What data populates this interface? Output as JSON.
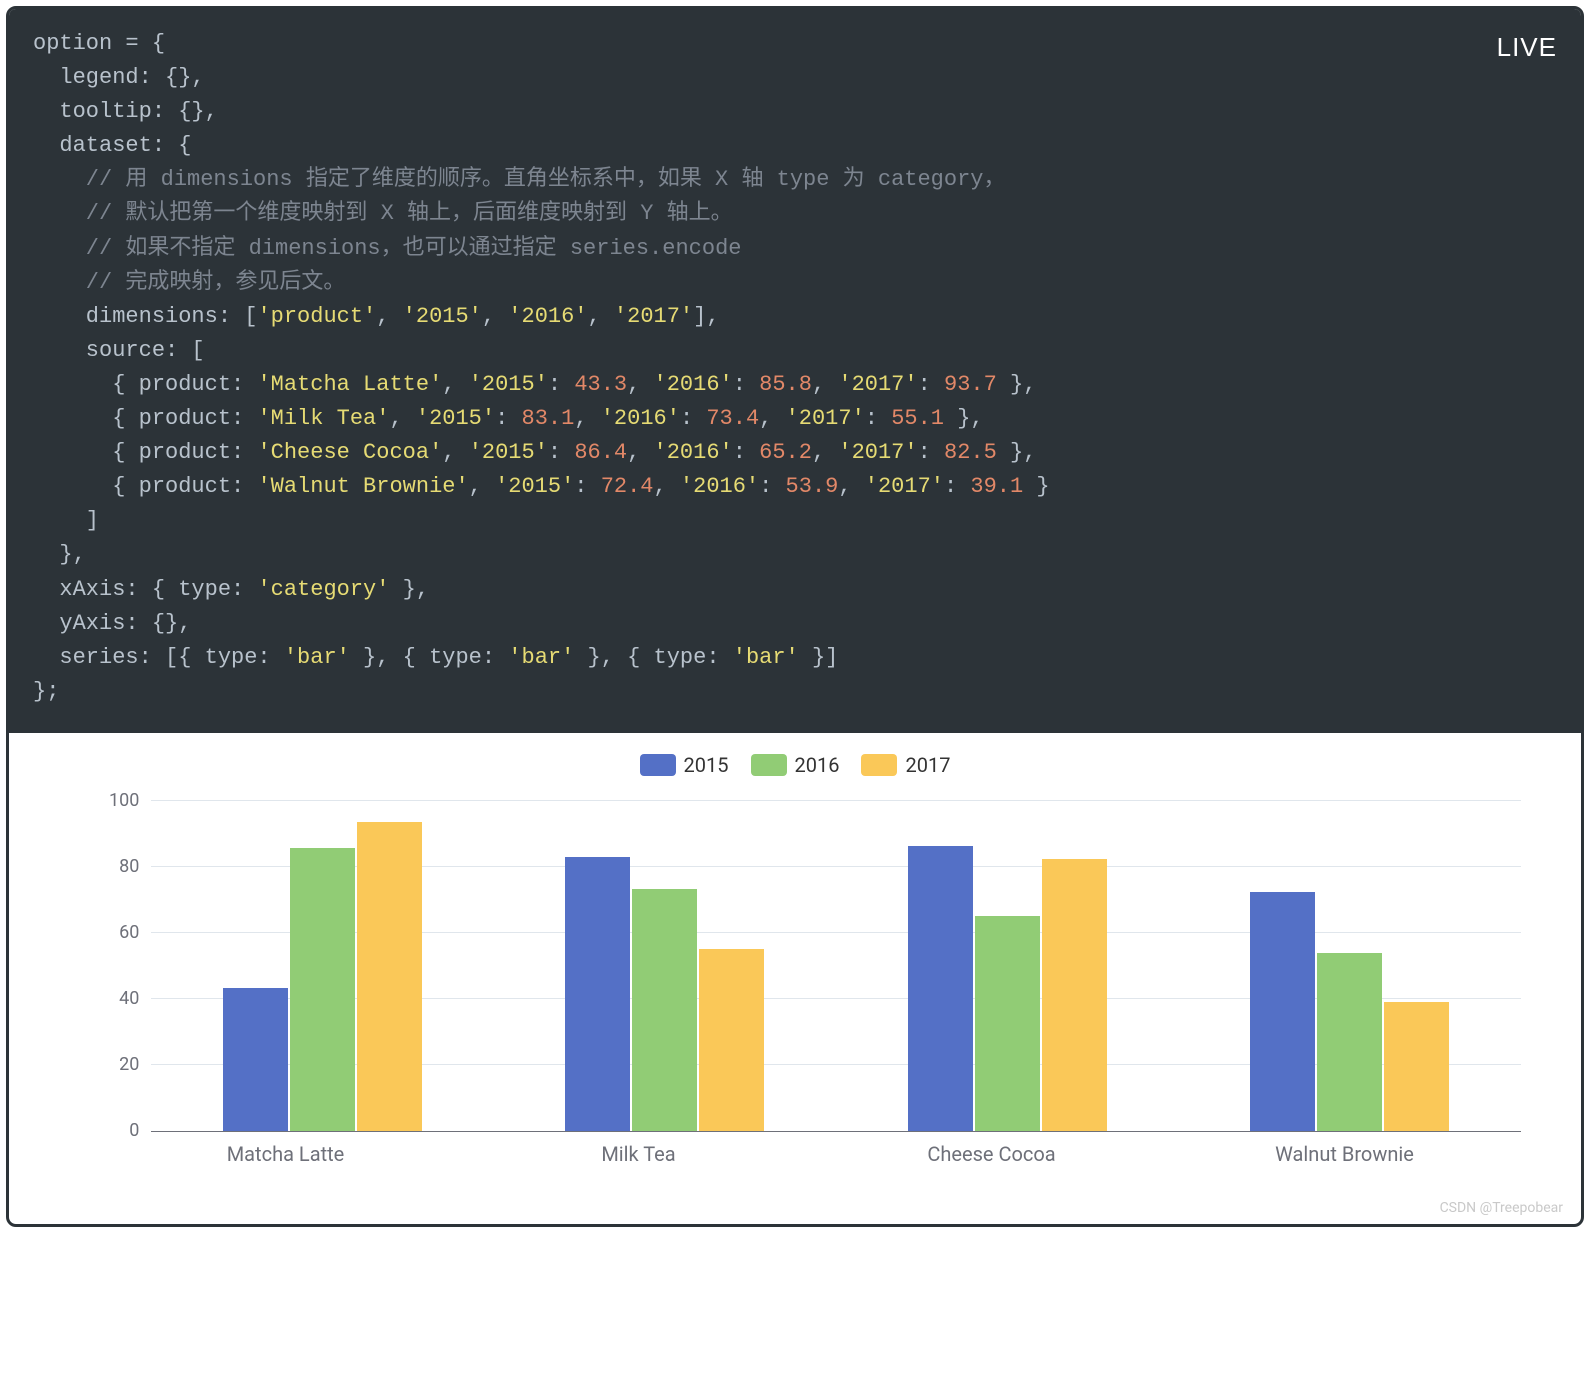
{
  "badge": "LIVE",
  "watermark": "CSDN @Treepobear",
  "code": {
    "l1": "option = {",
    "l2": "  legend: {},",
    "l3": "  tooltip: {},",
    "l4": "  dataset: {",
    "c1": "    // 用 dimensions 指定了维度的顺序。直角坐标系中，如果 X 轴 type 为 category，",
    "c2": "    // 默认把第一个维度映射到 X 轴上，后面维度映射到 Y 轴上。",
    "c3": "    // 如果不指定 dimensions，也可以通过指定 series.encode",
    "c4": "    // 完成映射，参见后文。",
    "dim_lead": "    dimensions: [",
    "dim_v0": "'product'",
    "dim_v1": "'2015'",
    "dim_v2": "'2016'",
    "dim_v3": "'2017'",
    "dim_tail": "],",
    "src_open": "    source: [",
    "row_lead": "      { product: ",
    "p0": "'Matcha Latte'",
    "p1": "'Milk Tea'",
    "p2": "'Cheese Cocoa'",
    "p3": "'Walnut Brownie'",
    "k15": "'2015'",
    "k16": "'2016'",
    "k17": "'2017'",
    "r0_15": "43.3",
    "r0_16": "85.8",
    "r0_17": "93.7",
    "r1_15": "83.1",
    "r1_16": "73.4",
    "r1_17": "55.1",
    "r2_15": "86.4",
    "r2_16": "65.2",
    "r2_17": "82.5",
    "r3_15": "72.4",
    "r3_16": "53.9",
    "r3_17": "39.1",
    "row_tail": " },",
    "row_tail_last": " }",
    "src_close": "    ]",
    "ds_close": "  },",
    "xaxis": "  xAxis: { type: ",
    "xaxis_val": "'category'",
    "xaxis_tail": " },",
    "yaxis": "  yAxis: {},",
    "series_lead": "  series: [{ type: ",
    "bar": "'bar'",
    "series_mid": " }, { type: ",
    "series_tail": " }]",
    "end": "};"
  },
  "chart_data": {
    "type": "bar",
    "categories": [
      "Matcha Latte",
      "Milk Tea",
      "Cheese Cocoa",
      "Walnut Brownie"
    ],
    "series": [
      {
        "name": "2015",
        "values": [
          43.3,
          83.1,
          86.4,
          72.4
        ],
        "color": "#5470c6"
      },
      {
        "name": "2016",
        "values": [
          85.8,
          73.4,
          65.2,
          53.9
        ],
        "color": "#91cc75"
      },
      {
        "name": "2017",
        "values": [
          93.7,
          55.1,
          82.5,
          39.1
        ],
        "color": "#fac858"
      }
    ],
    "ylim": [
      0,
      100
    ],
    "yticks": [
      0,
      20,
      40,
      60,
      80,
      100
    ],
    "xlabel": "",
    "ylabel": "",
    "title": ""
  }
}
